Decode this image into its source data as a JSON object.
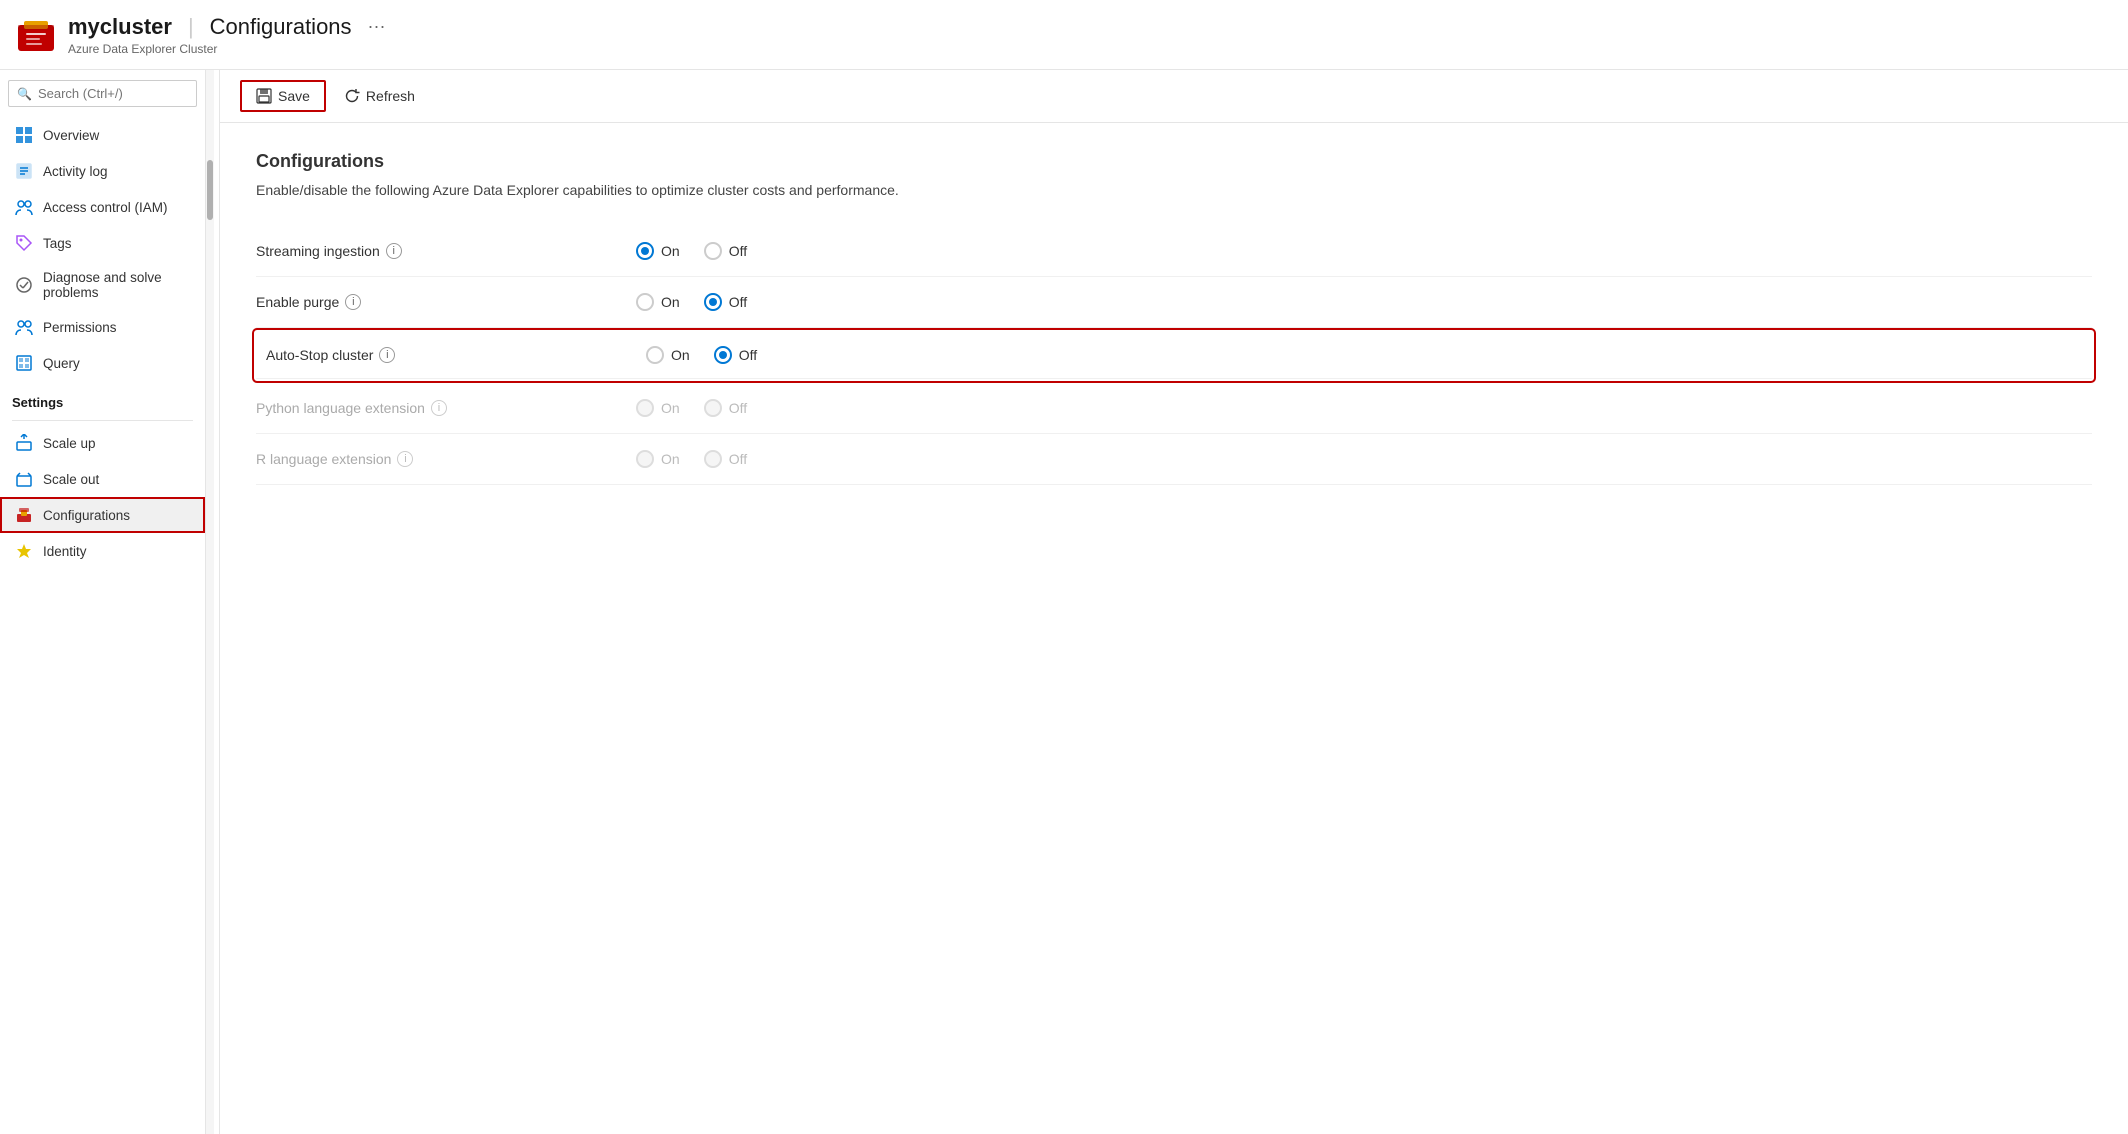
{
  "header": {
    "cluster_name": "mycluster",
    "separator": "|",
    "page_title": "Configurations",
    "subtitle": "Azure Data Explorer Cluster",
    "ellipsis": "···"
  },
  "search": {
    "placeholder": "Search (Ctrl+/)"
  },
  "sidebar": {
    "items": [
      {
        "id": "overview",
        "label": "Overview",
        "icon": "grid-icon"
      },
      {
        "id": "activity-log",
        "label": "Activity log",
        "icon": "activity-icon"
      },
      {
        "id": "access-control",
        "label": "Access control (IAM)",
        "icon": "iam-icon"
      },
      {
        "id": "tags",
        "label": "Tags",
        "icon": "tags-icon"
      },
      {
        "id": "diagnose",
        "label": "Diagnose and solve problems",
        "icon": "diagnose-icon"
      },
      {
        "id": "permissions",
        "label": "Permissions",
        "icon": "permissions-icon"
      },
      {
        "id": "query",
        "label": "Query",
        "icon": "query-icon"
      }
    ],
    "settings_label": "Settings",
    "settings_items": [
      {
        "id": "scale-up",
        "label": "Scale up",
        "icon": "scaleup-icon"
      },
      {
        "id": "scale-out",
        "label": "Scale out",
        "icon": "scaleout-icon"
      },
      {
        "id": "configurations",
        "label": "Configurations",
        "icon": "config-icon",
        "active": true
      },
      {
        "id": "identity",
        "label": "Identity",
        "icon": "identity-icon"
      }
    ]
  },
  "toolbar": {
    "save_label": "Save",
    "refresh_label": "Refresh"
  },
  "content": {
    "title": "Configurations",
    "description": "Enable/disable the following Azure Data Explorer capabilities to optimize cluster costs and performance.",
    "rows": [
      {
        "id": "streaming-ingestion",
        "label": "Streaming ingestion",
        "disabled": false,
        "on_checked": true,
        "off_checked": false,
        "highlighted": false
      },
      {
        "id": "enable-purge",
        "label": "Enable purge",
        "disabled": false,
        "on_checked": false,
        "off_checked": true,
        "highlighted": false
      },
      {
        "id": "auto-stop-cluster",
        "label": "Auto-Stop cluster",
        "disabled": false,
        "on_checked": false,
        "off_checked": true,
        "highlighted": true
      },
      {
        "id": "python-language-extension",
        "label": "Python language extension",
        "disabled": true,
        "on_checked": false,
        "off_checked": false,
        "highlighted": false
      },
      {
        "id": "r-language-extension",
        "label": "R language extension",
        "disabled": true,
        "on_checked": false,
        "off_checked": false,
        "highlighted": false
      }
    ],
    "on_label": "On",
    "off_label": "Off"
  }
}
